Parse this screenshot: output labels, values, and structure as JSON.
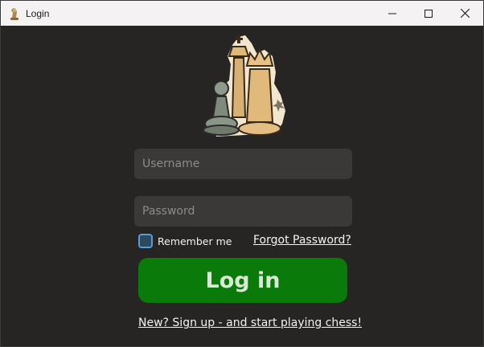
{
  "window": {
    "title": "Login",
    "icon": "chess-pieces-icon"
  },
  "title_controls": {
    "minimize_icon": "minimize-icon",
    "maximize_icon": "maximize-icon",
    "close_icon": "close-icon"
  },
  "logo": {
    "icon": "chess-pieces-logo"
  },
  "form": {
    "username": {
      "placeholder": "Username",
      "value": ""
    },
    "password": {
      "placeholder": "Password",
      "value": ""
    },
    "remember_label": "Remember me",
    "remember_checked": false,
    "forgot_link": "Forgot Password?",
    "login_button": "Log in",
    "signup_link": "New? Sign up - and start playing chess!"
  },
  "colors": {
    "background": "#262524",
    "field_bg": "#3a3938",
    "login_button": "#0a7a0a",
    "checkbox_border": "#5b9bd5"
  }
}
